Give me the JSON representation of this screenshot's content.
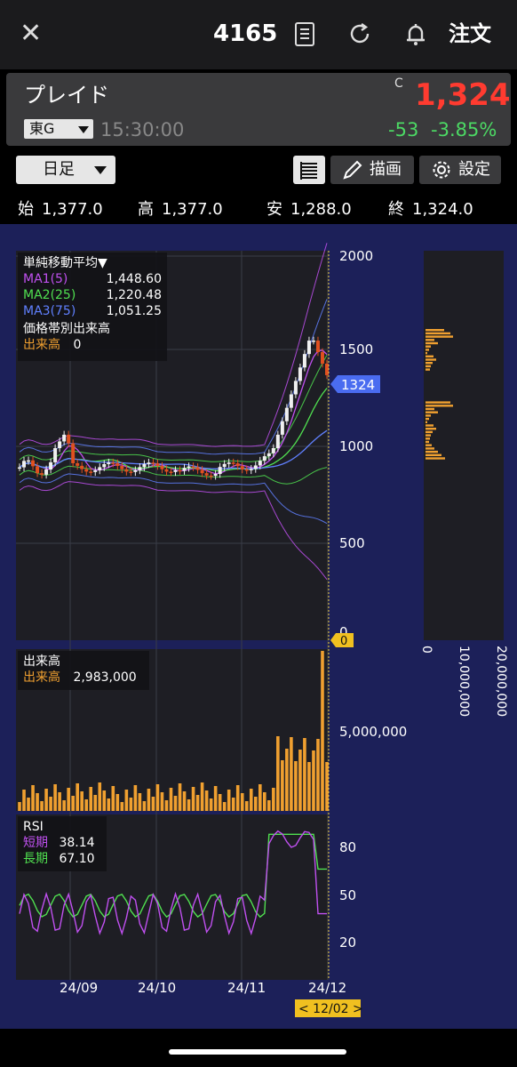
{
  "topbar": {
    "close_icon": "close-icon",
    "code": "4165",
    "icons": [
      "document-icon",
      "refresh-icon",
      "bell-icon"
    ],
    "order_label": "注文"
  },
  "quote": {
    "name": "プレイド",
    "exchange": "東G",
    "time": "15:30:00",
    "close_marker": "C",
    "price": "1,324",
    "change": "-53",
    "change_pct": "-3.85%",
    "colors": {
      "price": "#ff3b30",
      "change": "#4cd964"
    }
  },
  "controls": {
    "period": "日足",
    "draw_label": "描画",
    "settings_label": "設定",
    "icons": [
      "list-icon",
      "pencil-icon",
      "gear-icon"
    ]
  },
  "ohlc": {
    "open_label": "始",
    "open": "1,377.0",
    "high_label": "高",
    "high": "1,377.0",
    "low_label": "安",
    "low": "1,288.0",
    "close_label": "終",
    "close": "1,324.0"
  },
  "legend_ma": {
    "title": "単純移動平均▼",
    "ma1_name": "MA1(5)",
    "ma1_value": "1,448.60",
    "ma2_name": "MA2(25)",
    "ma2_value": "1,220.48",
    "ma3_name": "MA3(75)",
    "ma3_value": "1,051.25",
    "vbp_title": "価格帯別出来高",
    "vbp_name": "出来高",
    "vbp_value": "0",
    "colors": {
      "ma1": "#c050f0",
      "ma2": "#50e050",
      "ma3": "#6080ff",
      "vbp": "#f0a030"
    }
  },
  "legend_vol": {
    "title": "出来高",
    "name": "出来高",
    "value": "2,983,000"
  },
  "legend_rsi": {
    "title": "RSI",
    "short_name": "短期",
    "short_value": "38.14",
    "long_name": "長期",
    "long_value": "67.10"
  },
  "price_axis": {
    "ticks": [
      "2000",
      "1500",
      "1000",
      "500",
      "0"
    ],
    "current_price_tag": "1324",
    "zero_tag": "0"
  },
  "volume_axis": {
    "ticks": [
      "5,000,000"
    ]
  },
  "rsi_axis": {
    "ticks": [
      "80",
      "50",
      "20"
    ]
  },
  "vbp_axis": {
    "ticks": [
      "0",
      "10,000,000",
      "20,000,000"
    ]
  },
  "x_axis": {
    "ticks": [
      "24/09",
      "24/10",
      "24/11",
      "24/12"
    ],
    "cursor_label": "< 12/02 >"
  },
  "chart_data": [
    {
      "type": "candlestick",
      "title": "",
      "ylim": [
        0,
        2000
      ],
      "x": [
        "24/09",
        "24/10",
        "24/11",
        "24/12"
      ],
      "last": {
        "open": 1377.0,
        "high": 1377.0,
        "low": 1288.0,
        "close": 1324.0
      },
      "series": [
        {
          "name": "MA1(5)",
          "last": 1448.6
        },
        {
          "name": "MA2(25)",
          "last": 1220.48
        },
        {
          "name": "MA3(75)",
          "last": 1051.25
        }
      ]
    },
    {
      "type": "bar",
      "title": "出来高",
      "last_value": 2983000
    },
    {
      "type": "line",
      "title": "RSI",
      "ylim": [
        0,
        100
      ],
      "series": [
        {
          "name": "短期",
          "last": 38.14
        },
        {
          "name": "長期",
          "last": 67.1
        }
      ]
    }
  ]
}
